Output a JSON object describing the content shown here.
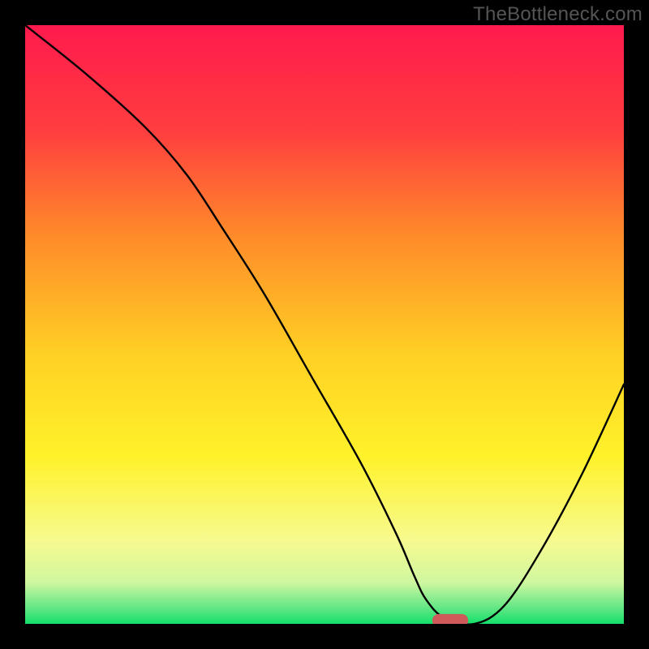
{
  "watermark": "TheBottleneck.com",
  "chart_data": {
    "type": "line",
    "title": "",
    "xlabel": "",
    "ylabel": "",
    "xlim": [
      0,
      100
    ],
    "ylim": [
      0,
      100
    ],
    "grid": false,
    "legend": false,
    "x": [
      0,
      10,
      20,
      27,
      33,
      40,
      48,
      56,
      62,
      65,
      67,
      70,
      75,
      80,
      86,
      93,
      100
    ],
    "values": [
      100,
      92,
      83,
      75,
      66,
      55,
      41,
      27,
      15,
      8,
      4,
      1,
      0,
      3,
      12,
      25,
      40
    ],
    "optimal_x": 71,
    "background": {
      "stops": [
        {
          "pct": 0,
          "color": "#ff1a4d"
        },
        {
          "pct": 18,
          "color": "#ff3f3f"
        },
        {
          "pct": 35,
          "color": "#ff8a2a"
        },
        {
          "pct": 55,
          "color": "#ffd024"
        },
        {
          "pct": 72,
          "color": "#fff22a"
        },
        {
          "pct": 86,
          "color": "#f7fa8f"
        },
        {
          "pct": 93,
          "color": "#d0f7a0"
        },
        {
          "pct": 97,
          "color": "#6be888"
        },
        {
          "pct": 100,
          "color": "#14e06a"
        }
      ]
    },
    "marker": {
      "color": "#cf5a5a",
      "w_pct": 6,
      "h_pct": 2.2
    }
  }
}
